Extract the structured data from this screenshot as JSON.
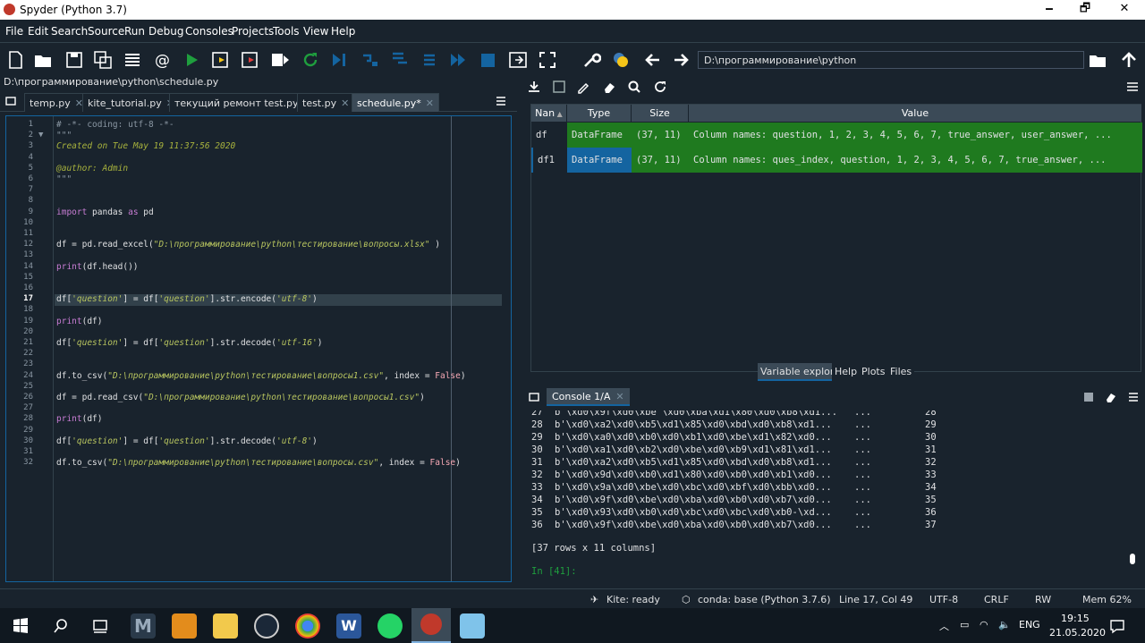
{
  "window": {
    "title": "Spyder (Python 3.7)",
    "minimize": "🗕",
    "maximize": "🗗",
    "close": "✕"
  },
  "menu": [
    "File",
    "Edit",
    "Search",
    "Source",
    "Run",
    "Debug",
    "Consoles",
    "Projects",
    "Tools",
    "View",
    "Help"
  ],
  "toolbar": {
    "path": "D:\\программирование\\python"
  },
  "editor": {
    "file_path": "D:\\программирование\\python\\schedule.py",
    "tabs": [
      {
        "label": "temp.py"
      },
      {
        "label": "kite_tutorial.py"
      },
      {
        "label": "текущий ремонт test.py"
      },
      {
        "label": "test.py"
      },
      {
        "label": "schedule.py*"
      }
    ],
    "line_numbers": [
      "1",
      "2",
      "3",
      "4",
      "5",
      "6",
      "7",
      "8",
      "9",
      "10",
      "11",
      "12",
      "13",
      "14",
      "15",
      "16",
      "17",
      "18",
      "19",
      "20",
      "21",
      "22",
      "23",
      "24",
      "25",
      "26",
      "27",
      "28",
      "29",
      "30",
      "31",
      "32"
    ],
    "lines": [
      "# -*- coding: utf-8 -*-",
      "\"\"\"",
      "Created on Tue May 19 11:37:56 2020",
      "",
      "@author: Admin",
      "\"\"\"",
      "",
      "",
      "import pandas as pd",
      "",
      "",
      "df = pd.read_excel(\"D:\\программирование\\python\\тестирование\\вопросы.xlsx\" )",
      "",
      "print(df.head())",
      "",
      "",
      "df['question'] = df['question'].str.encode('utf-8')",
      "",
      "print(df)",
      "",
      "df['question'] = df['question'].str.decode('utf-16')",
      "",
      "",
      "df.to_csv(\"D:\\программирование\\python\\тестирование\\вопросы1.csv\", index = False)",
      "",
      "df = pd.read_csv(\"D:\\программирование\\python\\тестирование\\вопросы1.csv\")",
      "",
      "print(df)",
      "",
      "df['question'] = df['question'].str.decode('utf-8')",
      "",
      "df.to_csv(\"D:\\программирование\\python\\тестирование\\вопросы.csv\", index = False)"
    ]
  },
  "variable_explorer": {
    "headers": [
      "Nan",
      "Type",
      "Size",
      "Value"
    ],
    "rows": [
      {
        "name": "df",
        "type": "DataFrame",
        "size": "(37, 11)",
        "value": "Column names: question, 1, 2, 3, 4, 5, 6, 7, true_answer, user_answer, ..."
      },
      {
        "name": "df1",
        "type": "DataFrame",
        "size": "(37, 11)",
        "value": "Column names: ques_index, question, 1, 2, 3, 4, 5, 6, 7, true_answer, ..."
      }
    ],
    "tabs": [
      "Variable explorer",
      "Help",
      "Plots",
      "Files"
    ]
  },
  "console": {
    "tab": "Console 1/A",
    "rows": [
      {
        "i": "27",
        "v": "b'\\xd0\\x9f\\xd0\\xbe \\xd0\\xba\\xd1\\x80\\xd0\\xb8\\xd1...",
        "dots": "...",
        "n": "28"
      },
      {
        "i": "28",
        "v": "b'\\xd0\\xa2\\xd0\\xb5\\xd1\\x85\\xd0\\xbd\\xd0\\xb8\\xd1...",
        "dots": "...",
        "n": "29"
      },
      {
        "i": "29",
        "v": "b'\\xd0\\xa0\\xd0\\xb0\\xd0\\xb1\\xd0\\xbe\\xd1\\x82\\xd0...",
        "dots": "...",
        "n": "30"
      },
      {
        "i": "30",
        "v": "b'\\xd0\\xa1\\xd0\\xb2\\xd0\\xbe\\xd0\\xb9\\xd1\\x81\\xd1...",
        "dots": "...",
        "n": "31"
      },
      {
        "i": "31",
        "v": "b'\\xd0\\xa2\\xd0\\xb5\\xd1\\x85\\xd0\\xbd\\xd0\\xb8\\xd1...",
        "dots": "...",
        "n": "32"
      },
      {
        "i": "32",
        "v": "b'\\xd0\\x9d\\xd0\\xb0\\xd1\\x80\\xd0\\xb0\\xd0\\xb1\\xd0...",
        "dots": "...",
        "n": "33"
      },
      {
        "i": "33",
        "v": "b'\\xd0\\x9a\\xd0\\xbe\\xd0\\xbc\\xd0\\xbf\\xd0\\xbb\\xd0...",
        "dots": "...",
        "n": "34"
      },
      {
        "i": "34",
        "v": "b'\\xd0\\x9f\\xd0\\xbe\\xd0\\xba\\xd0\\xb0\\xd0\\xb7\\xd0...",
        "dots": "...",
        "n": "35"
      },
      {
        "i": "35",
        "v": "b'\\xd0\\x93\\xd0\\xb0\\xd0\\xbc\\xd0\\xbc\\xd0\\xb0-\\xd...",
        "dots": "...",
        "n": "36"
      },
      {
        "i": "36",
        "v": "b'\\xd0\\x9f\\xd0\\xbe\\xd0\\xba\\xd0\\xb0\\xd0\\xb7\\xd0...",
        "dots": "...",
        "n": "37"
      }
    ],
    "summary": "[37 rows x 11 columns]",
    "prompt": "In [41]:"
  },
  "statusbar": {
    "kite": "Kite: ready",
    "conda": "conda: base (Python 3.7.6)",
    "position": "Line 17, Col 49",
    "encoding": "UTF-8",
    "eol": "CRLF",
    "rw": "RW",
    "mem": "Mem 62%"
  },
  "taskbar": {
    "lang": "ENG",
    "time": "19:15",
    "date": "21.05.2020"
  },
  "colors": {
    "bg": "#19232d",
    "accent": "#1464a0",
    "green": "#1f7a1f"
  }
}
